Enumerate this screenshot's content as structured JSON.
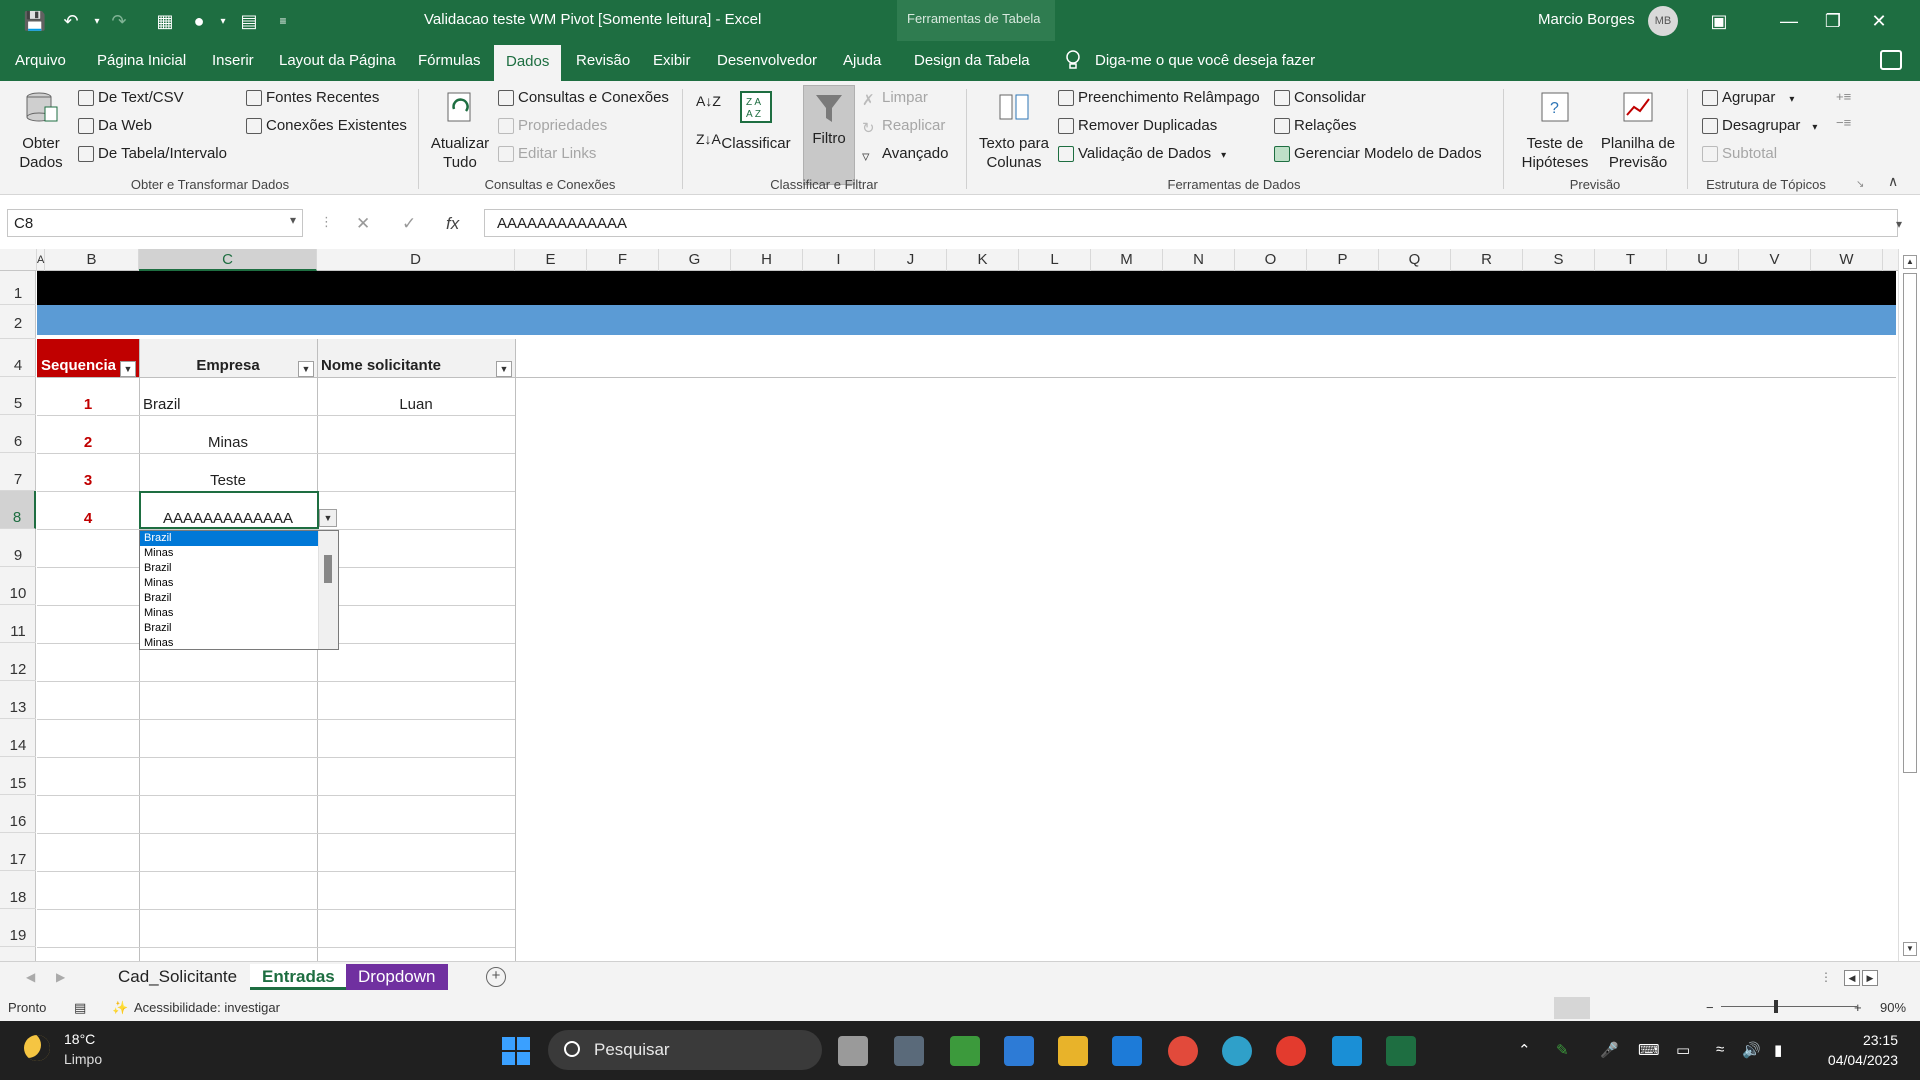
{
  "window": {
    "title": "Validacao teste WM Pivot  [Somente leitura]  -  Excel",
    "table_tools": "Ferramentas de Tabela",
    "user": "Marcio Borges",
    "avatar_initials": "MB"
  },
  "tabs": [
    "Arquivo",
    "Página Inicial",
    "Inserir",
    "Layout da Página",
    "Fórmulas",
    "Dados",
    "Revisão",
    "Exibir",
    "Desenvolvedor",
    "Ajuda",
    "Design da Tabela"
  ],
  "active_tab": "Dados",
  "tell_me": "Diga-me o que você deseja fazer",
  "ribbon": {
    "get_data": "Obter Dados",
    "from_text": "De Text/CSV",
    "from_web": "Da Web",
    "from_table": "De Tabela/Intervalo",
    "recent_sources": "Fontes Recentes",
    "existing_connections": "Conexões Existentes",
    "group_get_transform": "Obter e Transformar Dados",
    "refresh_all": "Atualizar Tudo",
    "queries_connections": "Consultas e Conexões",
    "properties": "Propriedades",
    "edit_links": "Editar Links",
    "group_queries": "Consultas e Conexões",
    "sort": "Classificar",
    "filter": "Filtro",
    "clear": "Limpar",
    "reapply": "Reaplicar",
    "advanced": "Avançado",
    "group_sort_filter": "Classificar e Filtrar",
    "text_to_columns": "Texto para Colunas",
    "flash_fill": "Preenchimento Relâmpago",
    "remove_duplicates": "Remover Duplicadas",
    "data_validation": "Validação de Dados",
    "consolidate": "Consolidar",
    "relationships": "Relações",
    "manage_data_model": "Gerenciar Modelo de Dados",
    "group_data_tools": "Ferramentas de Dados",
    "what_if": "Teste de Hipóteses",
    "forecast_sheet": "Planilha de Previsão",
    "group_forecast": "Previsão",
    "group_btn": "Agrupar",
    "ungroup_btn": "Desagrupar",
    "subtotal": "Subtotal",
    "group_outline": "Estrutura de Tópicos"
  },
  "formula_bar": {
    "name_box": "C8",
    "formula": "AAAAAAAAAAAAA"
  },
  "columns": [
    "A",
    "B",
    "C",
    "D",
    "E",
    "F",
    "G",
    "H",
    "I",
    "J",
    "K",
    "L",
    "M",
    "N",
    "O",
    "P",
    "Q",
    "R",
    "S",
    "T",
    "U",
    "V",
    "W"
  ],
  "rows": [
    "1",
    "2",
    "4",
    "5",
    "6",
    "7",
    "8",
    "9",
    "10",
    "11",
    "12",
    "13",
    "14",
    "15",
    "16",
    "17",
    "18",
    "19"
  ],
  "table": {
    "headers": [
      "Sequencia",
      "Empresa",
      "Nome solicitante"
    ],
    "rows": [
      {
        "seq": "1",
        "empresa": "Brazil",
        "nome": "Luan"
      },
      {
        "seq": "2",
        "empresa": "Minas",
        "nome": ""
      },
      {
        "seq": "3",
        "empresa": "Teste",
        "nome": ""
      },
      {
        "seq": "4",
        "empresa": "AAAAAAAAAAAAA",
        "nome": ""
      }
    ]
  },
  "dropdown_list": {
    "options": [
      "Brazil",
      "Minas",
      "Brazil",
      "Minas",
      "Brazil",
      "Minas",
      "Brazil",
      "Minas"
    ],
    "selected": "Brazil"
  },
  "sheet_tabs": [
    "Cad_Solicitante",
    "Entradas",
    "Dropdown"
  ],
  "active_sheet": "Entradas",
  "status": {
    "ready": "Pronto",
    "accessibility": "Acessibilidade: investigar",
    "zoom": "90%"
  },
  "taskbar": {
    "temperature": "18°C",
    "weather": "Limpo",
    "search": "Pesquisar",
    "time": "23:15",
    "date": "04/04/2023"
  },
  "colors": {
    "excel_green": "#1e6e41",
    "header_red": "#c00000",
    "band_blue": "#5b9bd5",
    "dropdown_purple": "#7030a0"
  }
}
